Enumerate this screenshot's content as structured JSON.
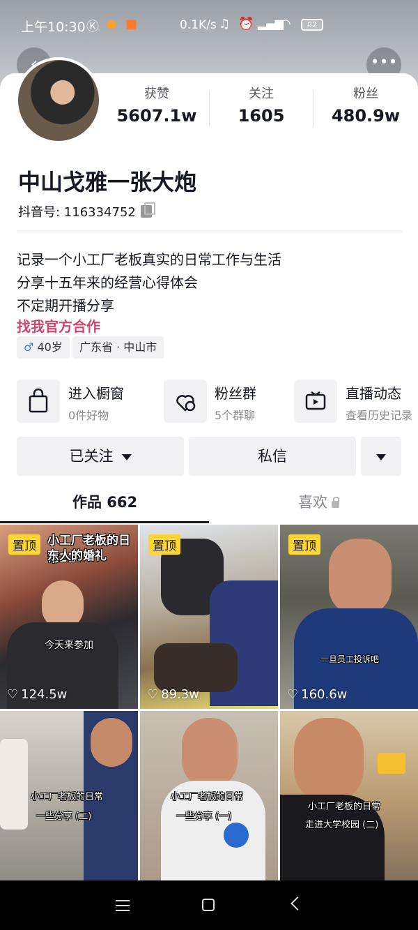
{
  "status_bar": {
    "time": "上午10:30",
    "network_speed": "0.1K/s",
    "battery": "82"
  },
  "profile": {
    "stats": [
      {
        "label": "获赞",
        "value": "5607.1w"
      },
      {
        "label": "关注",
        "value": "1605"
      },
      {
        "label": "粉丝",
        "value": "480.9w"
      }
    ],
    "name": "中山戈雅一张大炮",
    "douyin_id": "抖音号: 116334752",
    "bio": [
      "记录一个小工厂老板真实的日常工作与生活",
      "分享十五年来的经营心得体会",
      "不定期开播分享"
    ],
    "official_link": "找我官方合作",
    "tags": {
      "gender_symbol": "♂",
      "age": "40岁",
      "location": "广东省 · 中山市"
    }
  },
  "services": [
    {
      "title": "进入橱窗",
      "subtitle": "0件好物",
      "icon": "shopping-bag-icon"
    },
    {
      "title": "粉丝群",
      "subtitle": "5个群聊",
      "icon": "fan-group-icon"
    },
    {
      "title": "直播动态",
      "subtitle": "查看历史记录",
      "icon": "live-tv-icon"
    }
  ],
  "actions": {
    "followed": "已关注",
    "message": "私信"
  },
  "tabs": {
    "works": "作品 662",
    "likes": "喜欢"
  },
  "videos": [
    {
      "pinned": "置顶",
      "title_line1": "小工厂老板的日常217",
      "title_line2": "东人的婚礼",
      "caption": "今天来参加",
      "likes": "124.5w"
    },
    {
      "pinned": "置顶",
      "caption": "",
      "likes": "89.3w"
    },
    {
      "pinned": "置顶",
      "caption": "一旦员工投诉吧",
      "likes": "160.6w"
    },
    {
      "caption_line1": "小工厂老板的日常",
      "caption_line2": "一些分享 (二)"
    },
    {
      "caption_line1": "小工厂老板的日常",
      "caption_line2": "一些分享 (一)"
    },
    {
      "caption_line1": "小工厂老板的日常",
      "caption_line2": "走进大学校园 (二)"
    }
  ],
  "colors": {
    "accent_pink": "#d4456b",
    "pin_yellow": "#fdd535"
  }
}
